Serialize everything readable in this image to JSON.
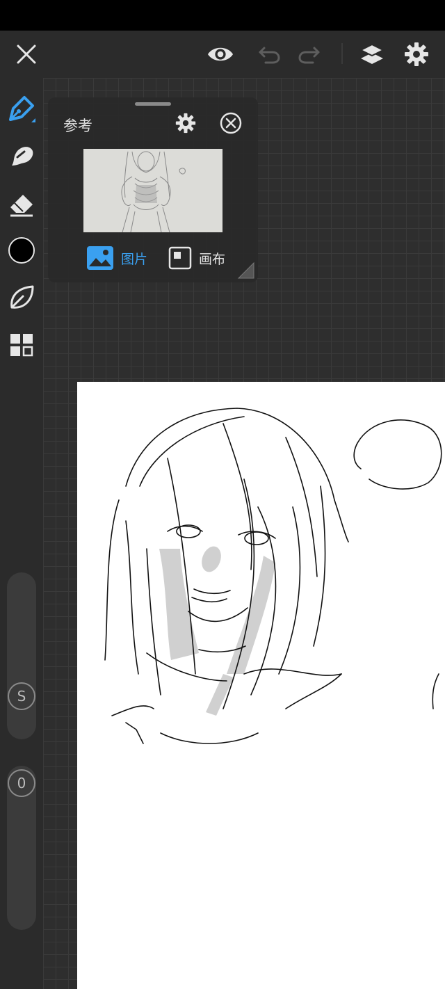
{
  "app": {
    "accent_color": "#3aa0f0",
    "panel_bg": "#2b2b2b",
    "canvas_bg": "#2e2e2e"
  },
  "top_toolbar": {
    "icons": [
      "close-icon",
      "eye-icon",
      "undo-icon",
      "redo-icon",
      "layers-icon",
      "settings-icon"
    ]
  },
  "left_toolbar": {
    "tools": [
      "pen-tool-icon",
      "smudge-tool-icon",
      "eraser-tool-icon",
      "color-swatch",
      "leaf-brush-icon",
      "grid-materials-icon"
    ],
    "current_color": "#000000",
    "size_slider_label": "S",
    "opacity_slider_label": "0"
  },
  "reference_panel": {
    "title": "参考",
    "tabs": [
      {
        "label": "图片",
        "active": true
      },
      {
        "label": "画布",
        "active": false
      }
    ]
  }
}
